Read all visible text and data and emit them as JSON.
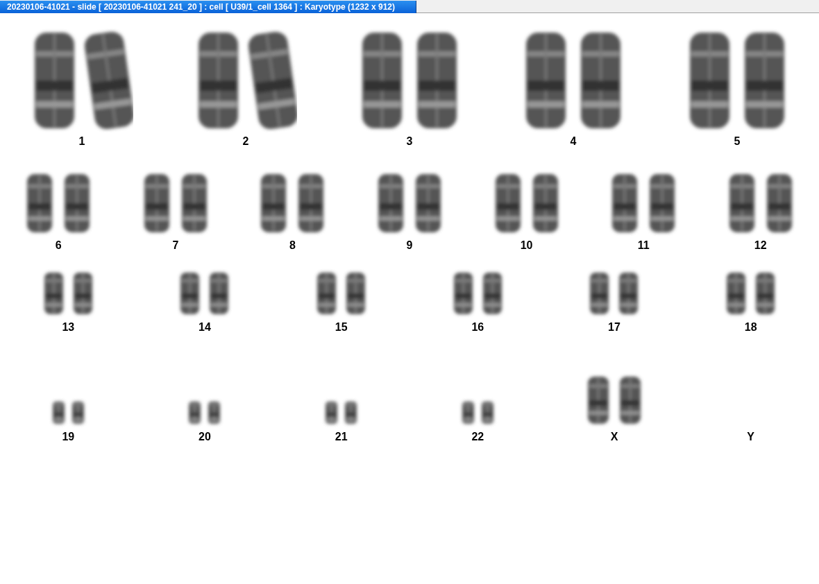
{
  "window": {
    "title": "20230106-41021 - slide [ 20230106-41021 241_20 ] : cell [ U39/1_cell 1364 ] : Karyotype  (1232 x 912)"
  },
  "karyotype": {
    "rows": [
      {
        "items": [
          {
            "label": "1",
            "kind": "pair"
          },
          {
            "label": "2",
            "kind": "pair"
          },
          {
            "label": "3",
            "kind": "pair"
          },
          {
            "label": "4",
            "kind": "pair"
          },
          {
            "label": "5",
            "kind": "pair"
          }
        ]
      },
      {
        "items": [
          {
            "label": "6",
            "kind": "pair"
          },
          {
            "label": "7",
            "kind": "pair"
          },
          {
            "label": "8",
            "kind": "pair"
          },
          {
            "label": "9",
            "kind": "pair"
          },
          {
            "label": "10",
            "kind": "pair"
          },
          {
            "label": "11",
            "kind": "pair"
          },
          {
            "label": "12",
            "kind": "pair"
          }
        ]
      },
      {
        "items": [
          {
            "label": "13",
            "kind": "pair"
          },
          {
            "label": "14",
            "kind": "pair"
          },
          {
            "label": "15",
            "kind": "pair"
          },
          {
            "label": "16",
            "kind": "pair"
          },
          {
            "label": "17",
            "kind": "pair"
          },
          {
            "label": "18",
            "kind": "pair"
          }
        ]
      },
      {
        "items": [
          {
            "label": "19",
            "kind": "pair"
          },
          {
            "label": "20",
            "kind": "pair"
          },
          {
            "label": "21",
            "kind": "pair"
          },
          {
            "label": "22",
            "kind": "pair"
          },
          {
            "label": "X",
            "kind": "pair"
          },
          {
            "label": "Y",
            "kind": "empty"
          }
        ]
      }
    ]
  }
}
